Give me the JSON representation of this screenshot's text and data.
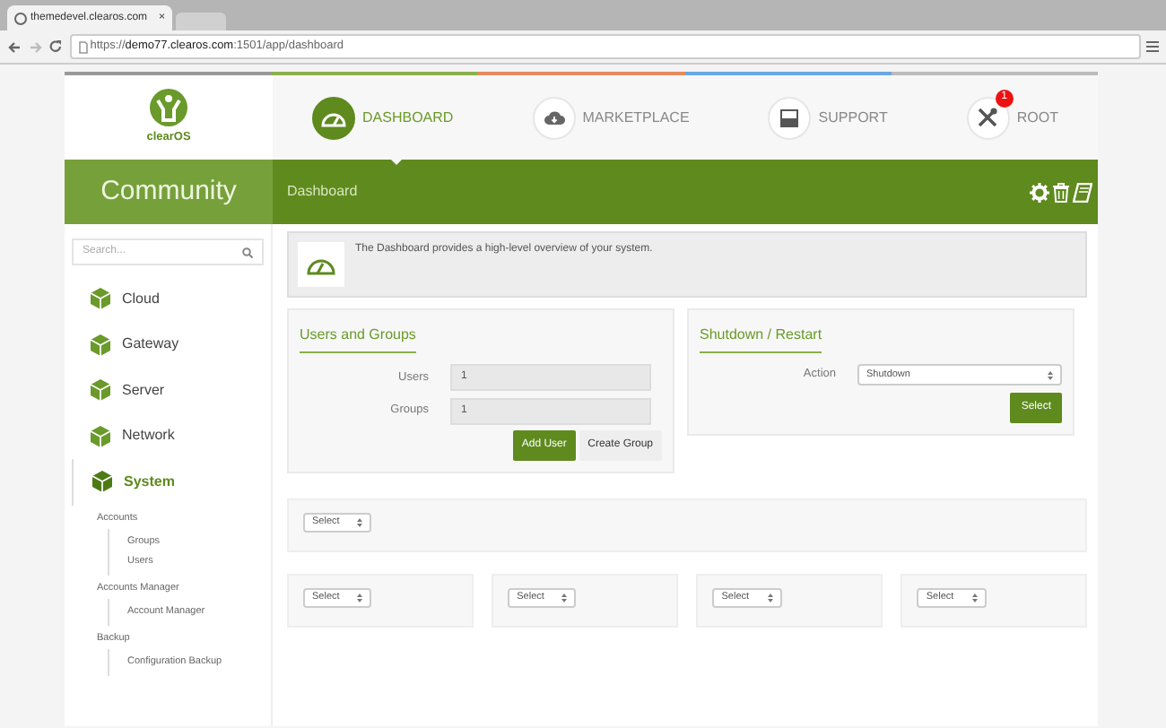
{
  "browser": {
    "tab_title": "themedevel.clearos.com",
    "close": "×",
    "url_prefix": "https://",
    "url_host": "demo77.clearos.com",
    "url_path": ":1501/app/dashboard"
  },
  "logo": {
    "text": "clearOS"
  },
  "nav": [
    {
      "label": "DASHBOARD",
      "selected": true
    },
    {
      "label": "MARKETPLACE",
      "selected": false
    },
    {
      "label": "SUPPORT",
      "selected": false
    },
    {
      "label": "ROOT",
      "selected": false,
      "badge": "1"
    }
  ],
  "edition": "Community",
  "breadcrumb": "Dashboard",
  "sidebar": {
    "search": {
      "placeholder": "Search..."
    },
    "items": [
      {
        "label": "Cloud",
        "selected": false
      },
      {
        "label": "Gateway",
        "selected": false
      },
      {
        "label": "Server",
        "selected": false
      },
      {
        "label": "Network",
        "selected": false
      },
      {
        "label": "System",
        "selected": true,
        "children": [
          {
            "label": "Accounts",
            "children": [
              {
                "label": "Groups"
              },
              {
                "label": "Users"
              }
            ]
          },
          {
            "label": "Accounts Manager",
            "children": [
              {
                "label": "Account Manager"
              }
            ]
          },
          {
            "label": "Backup",
            "children": [
              {
                "label": "Configuration Backup"
              }
            ]
          }
        ]
      }
    ]
  },
  "info": "The Dashboard provides a high-level overview of your system.",
  "users_groups": {
    "title": "Users and Groups",
    "fields": [
      {
        "label": "Users",
        "value": "1"
      },
      {
        "label": "Groups",
        "value": "1"
      }
    ],
    "buttons": [
      {
        "label": "Add User",
        "kind": "primary"
      },
      {
        "label": "Create Group",
        "kind": "secondary"
      }
    ]
  },
  "shutdown": {
    "title": "Shutdown / Restart",
    "field": {
      "label": "Action",
      "value": "Shutdown"
    },
    "button": "Select"
  },
  "widget_rows": [
    [
      "Select"
    ],
    [
      "Select",
      "Select",
      "Select",
      "Select"
    ]
  ]
}
